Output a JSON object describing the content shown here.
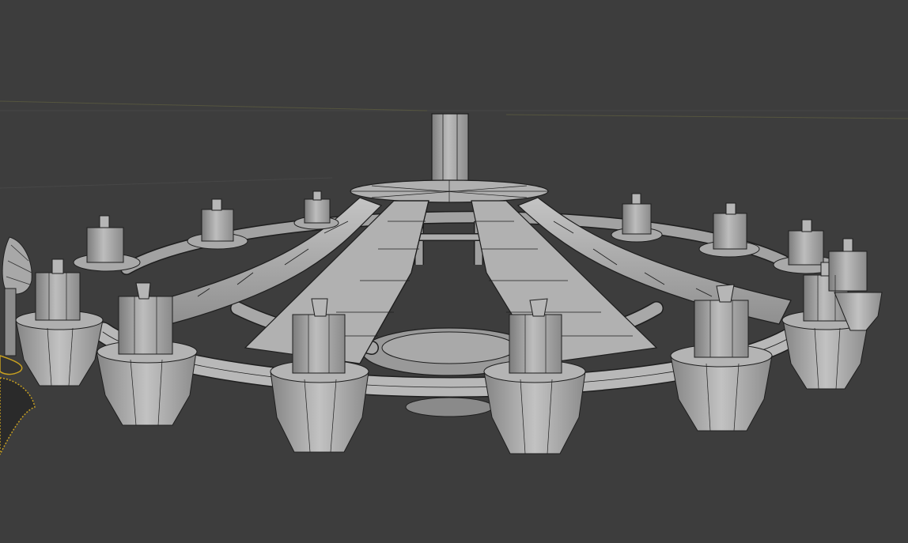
{
  "viewport": {
    "background": "#3d3d3d",
    "grid_line": "#4a4a4a",
    "horizon_line": "#5a5a4a"
  },
  "model": {
    "name": "chandelier",
    "surface_light": "#b4b4b4",
    "surface_mid": "#9a9a9a",
    "surface_dark": "#6f6f6f",
    "edge_color": "#1e1e1e",
    "candle_count_visible": 14,
    "arm_count_visible": 6
  },
  "side_object": {
    "name": "partial-object-left",
    "accent": "#c8a020"
  }
}
